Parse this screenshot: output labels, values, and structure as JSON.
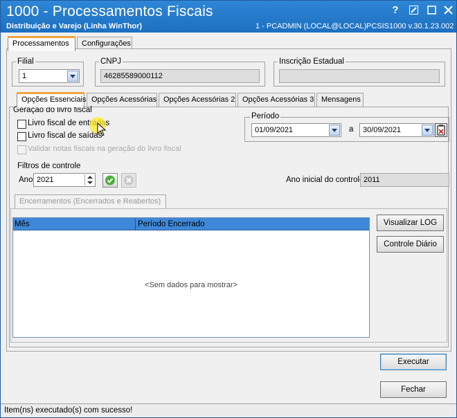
{
  "window": {
    "title": "1000 - Processamentos Fiscais",
    "subtitle": "Distribuição e Varejo (Linha WinThor)",
    "user_info": "1 - PCADMIN (LOCAL@LOCAL)",
    "program_info": "PCSIS1000  v.30.1.23.002"
  },
  "top_tabs": [
    {
      "label": "Processamentos",
      "active": true
    },
    {
      "label": "Configurações",
      "active": false
    }
  ],
  "filial": {
    "label": "Filial",
    "value": "1"
  },
  "cnpj": {
    "label": "CNPJ",
    "value": "46285589000112"
  },
  "inscricao": {
    "label": "Inscrição Estadual",
    "value": ""
  },
  "sub_tabs": [
    {
      "label": "Opções Essenciais",
      "active": true
    },
    {
      "label": "Opções Acessórias",
      "active": false
    },
    {
      "label": "Opções Acessórias 2",
      "active": false
    },
    {
      "label": "Opções Acessórias 3",
      "active": false
    },
    {
      "label": "Mensagens",
      "active": false
    }
  ],
  "geracao": {
    "label": "Geração do livro fiscal",
    "entradas": "Livro fiscal de entradas",
    "saidas": "Livro fiscal de saídas",
    "validar": "Validar notas fiscais na geração do livro fiscal"
  },
  "periodo": {
    "label": "Período",
    "start": "01/09/2021",
    "separator": "a",
    "end": "30/09/2021"
  },
  "filtros": {
    "label": "Filtros de controle",
    "ano_label": "Ano",
    "ano_value": "2021",
    "ano_inicial_label": "Ano inicial do controle",
    "ano_inicial_value": "2011"
  },
  "encerramentos": {
    "tab_label": "Encerramentos (Encerrados e Reabertos)",
    "columns": [
      "Mês",
      "Período Encerrado"
    ],
    "empty_text": "<Sem dados para mostrar>"
  },
  "buttons": {
    "visualizar_log": "Visualizar LOG",
    "controle_diario": "Controle Diário",
    "executar": "Executar",
    "fechar": "Fechar"
  },
  "status": "Item(ns) executado(s) com sucesso!",
  "colors": {
    "titlebar": "#1d6fc0",
    "accent_tab": "#f1a33b",
    "grid_header": "#3f88d8"
  }
}
